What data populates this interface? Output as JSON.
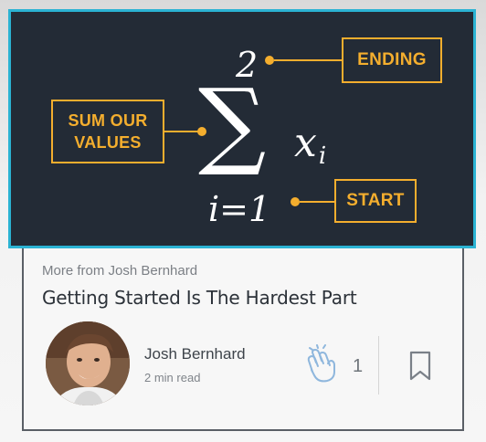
{
  "hero": {
    "math": {
      "symbol": "∑",
      "upper_limit": "2",
      "lower_limit": "i=1",
      "term_main": "x",
      "term_sub": "i"
    },
    "labels": {
      "ending": "ENDING",
      "sum_line1": "SUM OUR",
      "sum_line2": "VALUES",
      "start": "START"
    },
    "colors": {
      "background": "#232b36",
      "accent": "#f4ae2e",
      "selection_border": "#2bb3d3"
    }
  },
  "article": {
    "more_from": "More from Josh Bernhard",
    "title": "Getting Started Is The Hardest Part"
  },
  "author": {
    "name": "Josh Bernhard",
    "read_time": "2 min read",
    "avatar_icon": "avatar-photo"
  },
  "actions": {
    "clap_icon": "clap-icon",
    "clap_count": "1",
    "bookmark_icon": "bookmark-icon"
  }
}
